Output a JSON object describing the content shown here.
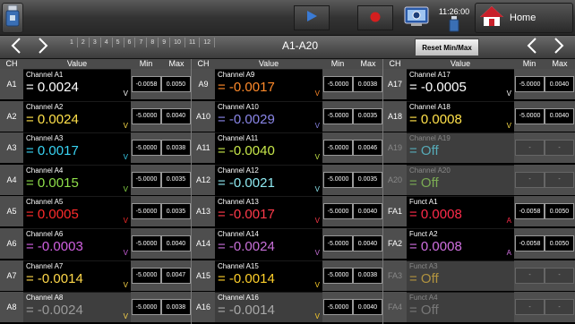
{
  "topbar": {
    "clock_time": "11:26:00",
    "home_label": "Home",
    "colors": {
      "play": "#3a7bd5",
      "record": "#d41f1f",
      "home_roof": "#c8202a"
    }
  },
  "navbar": {
    "pages": [
      "1",
      "2",
      "3",
      "4",
      "5",
      "6",
      "7",
      "8",
      "9",
      "10",
      "11",
      "12"
    ],
    "range_title": "A1-A20",
    "reset_label": "Reset Min/Max"
  },
  "headers": {
    "ch": "CH",
    "value": "Value",
    "min": "Min",
    "max": "Max"
  },
  "columns": [
    [
      {
        "ch": "A1",
        "name": "Channel A1",
        "value": "= 0.0024",
        "unit": "V",
        "min": "-0.0058",
        "max": "0.0050",
        "color": "#ffffff",
        "unit_color": "#ffffff",
        "state": "on"
      },
      {
        "ch": "A2",
        "name": "Channel A2",
        "value": "= 0.0024",
        "unit": "V",
        "min": "-5.0000",
        "max": "0.0040",
        "color": "#ffe14a",
        "unit_color": "#ffe14a",
        "state": "on"
      },
      {
        "ch": "A3",
        "name": "Channel A3",
        "value": "= 0.0017",
        "unit": "V",
        "min": "-5.0000",
        "max": "0.0038",
        "color": "#39d4f4",
        "unit_color": "#39d4f4",
        "state": "on"
      },
      {
        "ch": "A4",
        "name": "Channel A4",
        "value": "= 0.0015",
        "unit": "V",
        "min": "-5.0000",
        "max": "0.0035",
        "color": "#8fe04a",
        "unit_color": "#8fe04a",
        "state": "on"
      },
      {
        "ch": "A5",
        "name": "Channel A5",
        "value": "= 0.0005",
        "unit": "V",
        "min": "-5.0000",
        "max": "0.0035",
        "color": "#ff2b2b",
        "unit_color": "#ff2b2b",
        "state": "on"
      },
      {
        "ch": "A6",
        "name": "Channel A6",
        "value": "= -0.0003",
        "unit": "V",
        "min": "-5.0000",
        "max": "0.0040",
        "color": "#d060e0",
        "unit_color": "#d060e0",
        "state": "on"
      },
      {
        "ch": "A7",
        "name": "Channel A7",
        "value": "= -0.0014",
        "unit": "V",
        "min": "-5.0000",
        "max": "0.0047",
        "color": "#ffd84a",
        "unit_color": "#ffd84a",
        "state": "on"
      },
      {
        "ch": "A8",
        "name": "Channel A8",
        "value": "= -0.0024",
        "unit": "V",
        "min": "-5.0000",
        "max": "0.0038",
        "color": "#9a9a9a",
        "unit_color": "#ffd84a",
        "state": "on-gray"
      }
    ],
    [
      {
        "ch": "A9",
        "name": "Channel A9",
        "value": "= -0.0017",
        "unit": "V",
        "min": "-5.0000",
        "max": "0.0038",
        "color": "#ff8a2a",
        "unit_color": "#ff8a2a",
        "state": "on"
      },
      {
        "ch": "A10",
        "name": "Channel A10",
        "value": "= -0.0029",
        "unit": "V",
        "min": "-5.0000",
        "max": "0.0035",
        "color": "#8a86e8",
        "unit_color": "#8a86e8",
        "state": "on"
      },
      {
        "ch": "A11",
        "name": "Channel A11",
        "value": "= -0.0040",
        "unit": "V",
        "min": "-5.0000",
        "max": "0.0046",
        "color": "#c8e84a",
        "unit_color": "#c8e84a",
        "state": "on"
      },
      {
        "ch": "A12",
        "name": "Channel A12",
        "value": "= -0.0021",
        "unit": "V",
        "min": "-5.0000",
        "max": "0.0035",
        "color": "#8ee8f0",
        "unit_color": "#8ee8f0",
        "state": "on"
      },
      {
        "ch": "A13",
        "name": "Channel A13",
        "value": "= -0.0017",
        "unit": "V",
        "min": "-5.0000",
        "max": "0.0040",
        "color": "#ff3a4a",
        "unit_color": "#ff3a4a",
        "state": "on"
      },
      {
        "ch": "A14",
        "name": "Channel A14",
        "value": "= -0.0024",
        "unit": "V",
        "min": "-5.0000",
        "max": "0.0040",
        "color": "#c870d8",
        "unit_color": "#c870d8",
        "state": "on"
      },
      {
        "ch": "A15",
        "name": "Channel A15",
        "value": "= -0.0014",
        "unit": "V",
        "min": "-5.0000",
        "max": "0.0038",
        "color": "#ffd02a",
        "unit_color": "#ffd02a",
        "state": "on"
      },
      {
        "ch": "A16",
        "name": "Channel A16",
        "value": "= -0.0014",
        "unit": "V",
        "min": "-5.0000",
        "max": "0.0040",
        "color": "#a8a8a8",
        "unit_color": "#ffd02a",
        "state": "on-gray"
      }
    ],
    [
      {
        "ch": "A17",
        "name": "Channel A17",
        "value": "= -0.0005",
        "unit": "V",
        "min": "-5.0000",
        "max": "0.0040",
        "color": "#ffffff",
        "unit_color": "#ffffff",
        "state": "on"
      },
      {
        "ch": "A18",
        "name": "Channel A18",
        "value": "= 0.0008",
        "unit": "V",
        "min": "-5.0000",
        "max": "0.0040",
        "color": "#ffe14a",
        "unit_color": "#ffe14a",
        "state": "on"
      },
      {
        "ch": "A19",
        "name": "Channel A19",
        "value": "= Off",
        "unit": "",
        "min": "-",
        "max": "-",
        "color": "#5fcfe0",
        "unit_color": "#5fcfe0",
        "state": "off"
      },
      {
        "ch": "A20",
        "name": "Channel A20",
        "value": "= Off",
        "unit": "",
        "min": "-",
        "max": "-",
        "color": "#8fcf5a",
        "unit_color": "#8fcf5a",
        "state": "off"
      },
      {
        "ch": "FA1",
        "name": "Funct A1",
        "value": "= 0.0008",
        "unit": "A",
        "min": "-0.0058",
        "max": "0.0050",
        "color": "#ff2b4a",
        "unit_color": "#ff2b4a",
        "state": "on"
      },
      {
        "ch": "FA2",
        "name": "Funct A2",
        "value": "= 0.0008",
        "unit": "A",
        "min": "-0.0058",
        "max": "0.0050",
        "color": "#d070e0",
        "unit_color": "#d070e0",
        "state": "on"
      },
      {
        "ch": "FA3",
        "name": "Funct A3",
        "value": "= Off",
        "unit": "",
        "min": "-",
        "max": "-",
        "color": "#d8b040",
        "unit_color": "#d8b040",
        "state": "off"
      },
      {
        "ch": "FA4",
        "name": "Funct A4",
        "value": "= Off",
        "unit": "",
        "min": "-",
        "max": "-",
        "color": "#8a8a8a",
        "unit_color": "#8a8a8a",
        "state": "off"
      }
    ]
  ]
}
